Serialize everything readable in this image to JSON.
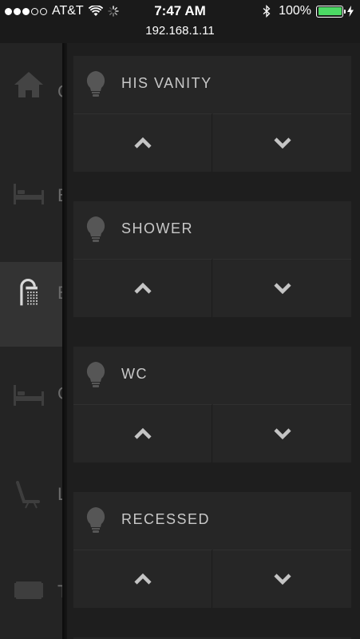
{
  "status_bar": {
    "carrier": "AT&T",
    "time": "7:47 AM",
    "battery": "100%",
    "signal_bars_filled": 3,
    "signal_bars_total": 5
  },
  "url": "192.168.1.11",
  "sidebar": {
    "items": [
      {
        "icon": "home-icon",
        "label": "C",
        "active": false
      },
      {
        "icon": "bed-icon",
        "label": "B",
        "active": false
      },
      {
        "icon": "shower-icon",
        "label": "B",
        "active": true
      },
      {
        "icon": "bed-icon",
        "label": "C",
        "active": false
      },
      {
        "icon": "lounge-chair-icon",
        "label": "L",
        "active": false
      },
      {
        "icon": "tv-icon",
        "label": "T",
        "active": false
      }
    ]
  },
  "lights": [
    {
      "title": "HIS VANITY",
      "up_icon": "chevron-up-icon",
      "down_icon": "chevron-down-icon"
    },
    {
      "title": "SHOWER",
      "up_icon": "chevron-up-icon",
      "down_icon": "chevron-down-icon"
    },
    {
      "title": "WC",
      "up_icon": "chevron-up-icon",
      "down_icon": "chevron-down-icon"
    },
    {
      "title": "RECESSED",
      "up_icon": "chevron-up-icon",
      "down_icon": "chevron-down-icon"
    }
  ],
  "colors": {
    "battery": "#4cd964",
    "active_sidebar": "#333333",
    "card": "#262626",
    "icon_gray": "#5a5a5a",
    "chevron": "#bdbdbd"
  }
}
